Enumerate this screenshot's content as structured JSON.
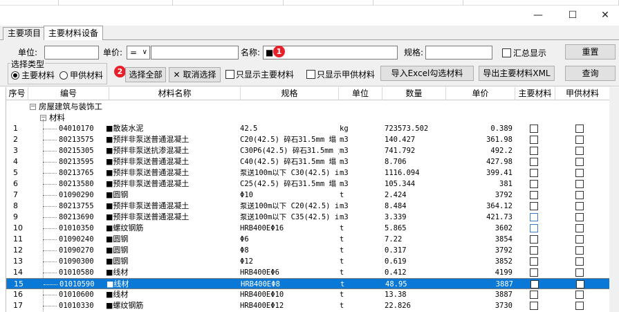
{
  "window": {
    "minimize": "—",
    "maximize": "☐",
    "close": "✕"
  },
  "tabs": [
    {
      "label": "主要项目"
    },
    {
      "label": "主要材料设备"
    }
  ],
  "filters": {
    "unit_label": "单位:",
    "unit_value": "",
    "price_label": "单价:",
    "price_op": "=",
    "price_value": "",
    "name_label": "名称:",
    "name_value": "■",
    "spec_label": "规格:",
    "spec_value": "",
    "summary_label": "汇总显示",
    "reset": "重置",
    "query": "查询",
    "type_group": "选择类型",
    "radio_main": "主要材料",
    "radio_supply": "甲供材料",
    "select_all": "选择全部",
    "cancel_select": "取消选择",
    "cancel_icon": "✕",
    "only_main": "只显示主要材料",
    "only_supply": "只显示甲供材料",
    "import_excel": "导入Excel勾选材料",
    "export_xml": "导出主要材料XML",
    "badge1": "1",
    "badge2": "2"
  },
  "columns": [
    "序号",
    "编号",
    "材料名称",
    "规格",
    "单位",
    "数量",
    "单价",
    "主要材料",
    "甲供材料"
  ],
  "tree": {
    "root": "房屋建筑与装饰工",
    "child": "材料",
    "expand": "−"
  },
  "rows": [
    {
      "no": "1",
      "code": "04010170",
      "name": "■散装水泥",
      "spec": "42.5",
      "unit": "kg",
      "qty": "723573.502",
      "price": "0.389"
    },
    {
      "no": "2",
      "code": "80213575",
      "name": "■预拌非泵送普通混凝土",
      "spec": "C20(42.5) 碎石31.5mm 塌",
      "unit": "m3",
      "qty": "140.427",
      "price": "361.98"
    },
    {
      "no": "3",
      "code": "80215305",
      "name": "■预拌非泵送抗渗混凝土",
      "spec": "C30P6(42.5) 碎石31.5mm j",
      "unit": "m3",
      "qty": "741.792",
      "price": "492.2"
    },
    {
      "no": "4",
      "code": "80213595",
      "name": "■预拌非泵送普通混凝土",
      "spec": "C40(42.5) 碎石31.5mm 塌",
      "unit": "m3",
      "qty": "8.706",
      "price": "427.98"
    },
    {
      "no": "5",
      "code": "80213765",
      "name": "■预拌非泵送普通混凝土",
      "spec": "泵送100m以下 C30(42.5) i",
      "unit": "m3",
      "qty": "1116.094",
      "price": "399.41"
    },
    {
      "no": "6",
      "code": "80213580",
      "name": "■预拌非泵送普通混凝土",
      "spec": "C25(42.5) 碎石31.5mm 塌",
      "unit": "m3",
      "qty": "105.344",
      "price": "381"
    },
    {
      "no": "7",
      "code": "01090290",
      "name": "■圆钢",
      "spec": "Φ10",
      "unit": "t",
      "qty": "2.424",
      "price": "3792"
    },
    {
      "no": "8",
      "code": "80213755",
      "name": "■预拌非泵送普通混凝土",
      "spec": "泵送100m以下 C20(42.5) i",
      "unit": "m3",
      "qty": "8.484",
      "price": "364.12"
    },
    {
      "no": "9",
      "code": "80213690",
      "name": "■预拌非泵送普通混凝土",
      "spec": "泵送100m以下 C35(42.5) i",
      "unit": "m3",
      "qty": "3.339",
      "price": "421.73"
    },
    {
      "no": "10",
      "code": "01010350",
      "name": "■螺纹钢筋",
      "spec": "HRB400EΦ16",
      "unit": "t",
      "qty": "5.865",
      "price": "3602"
    },
    {
      "no": "11",
      "code": "01090240",
      "name": "■圆钢",
      "spec": "Φ6",
      "unit": "t",
      "qty": "7.22",
      "price": "3854"
    },
    {
      "no": "12",
      "code": "01090270",
      "name": "■圆钢",
      "spec": "Φ8",
      "unit": "t",
      "qty": "0.317",
      "price": "3792"
    },
    {
      "no": "13",
      "code": "01090300",
      "name": "■圆钢",
      "spec": "Φ12",
      "unit": "t",
      "qty": "0.619",
      "price": "3852"
    },
    {
      "no": "14",
      "code": "01010580",
      "name": "■线材",
      "spec": "HRB400EΦ6",
      "unit": "t",
      "qty": "0.412",
      "price": "4199"
    },
    {
      "no": "15",
      "code": "01010590",
      "name": "■线材",
      "spec": "HRB400EΦ8",
      "unit": "t",
      "qty": "48.95",
      "price": "3887"
    },
    {
      "no": "16",
      "code": "01010600",
      "name": "■线材",
      "spec": "HRB400EΦ10",
      "unit": "t",
      "qty": "13.38",
      "price": "3887"
    },
    {
      "no": "17",
      "code": "01010330",
      "name": "■螺纹钢筋",
      "spec": "HRB400EΦ12",
      "unit": "t",
      "qty": "22.826",
      "price": "3730"
    }
  ],
  "selected_row": "15",
  "colors": {
    "selection": "#0a78d7",
    "badge": "#e8202a"
  }
}
